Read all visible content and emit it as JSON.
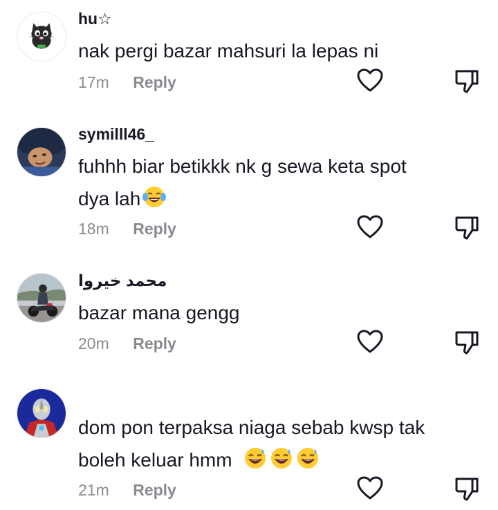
{
  "comments": [
    {
      "username": "hu☆",
      "text": "nak pergi bazar mahsuri la lepas ni",
      "time": "17m",
      "reply_label": "Reply",
      "avatar": "cat-avatar"
    },
    {
      "username": "symilll46_",
      "text": "fuhhh biar betikkk nk g sewa keta spot",
      "text_line2": "dya lah",
      "emoji_names": [
        "tears-of-joy-emoji"
      ],
      "time": "18m",
      "reply_label": "Reply",
      "avatar": "person-avatar"
    },
    {
      "username": "محمد خيروا",
      "text": "bazar mana gengg",
      "time": "20m",
      "reply_label": "Reply",
      "avatar": "motorcycle-avatar"
    },
    {
      "username": "",
      "text": "dom pon terpaksa niaga sebab kwsp tak",
      "text_line2": "boleh keluar hmm",
      "emoji_names": [
        "sweat-smile-emoji",
        "sweat-smile-emoji",
        "sweat-smile-emoji"
      ],
      "time": "21m",
      "reply_label": "Reply",
      "avatar": "ultraman-avatar"
    }
  ],
  "icons": {
    "like": "heart-outline-icon",
    "dislike": "thumbs-down-icon"
  },
  "colors": {
    "text_primary": "#161823",
    "text_secondary": "#8a8b91",
    "icon": "#161823"
  }
}
